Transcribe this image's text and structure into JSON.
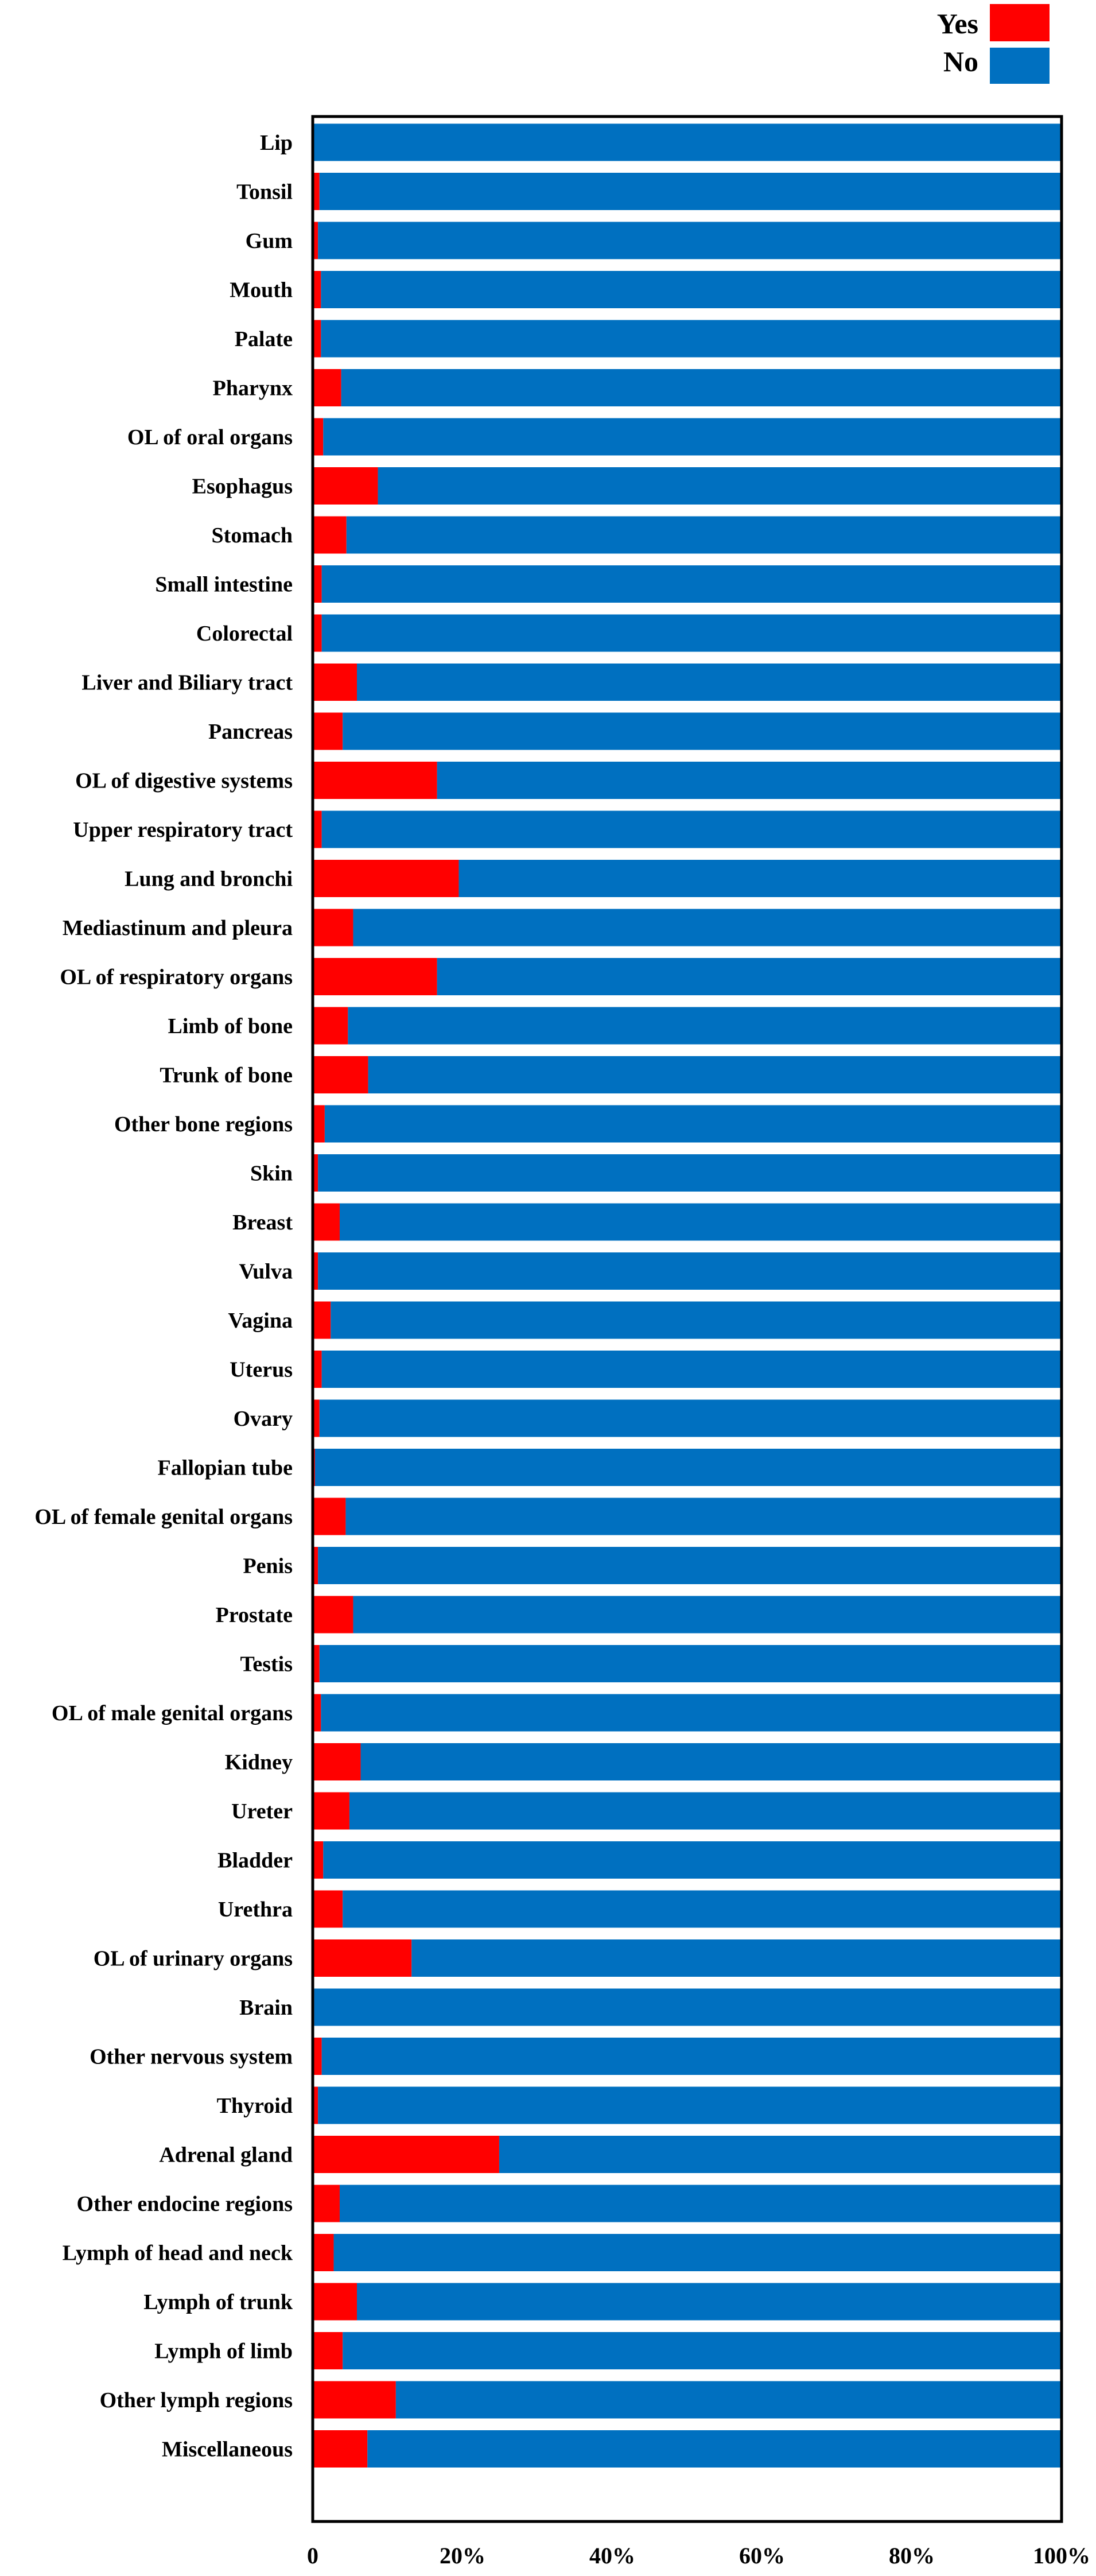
{
  "chart_data": {
    "type": "bar",
    "orientation": "horizontal",
    "stacked": true,
    "normalized": true,
    "title": "",
    "xlabel": "",
    "ylabel": "",
    "xlim": [
      0,
      100
    ],
    "x_ticks": [
      "0",
      "20%",
      "40%",
      "60%",
      "80%",
      "100%"
    ],
    "x_tick_values": [
      0,
      20,
      40,
      60,
      80,
      100
    ],
    "grid": false,
    "legend": {
      "placement": "top-right",
      "entries": [
        {
          "name": "Yes",
          "color": "#ff0000"
        },
        {
          "name": "No",
          "color": "#0070c0"
        }
      ]
    },
    "categories": [
      "Lip",
      "Tonsil",
      "Gum",
      "Mouth",
      "Palate",
      "Pharynx",
      "OL of oral organs",
      "Esophagus",
      "Stomach",
      "Small intestine",
      "Colorectal",
      "Liver and Biliary tract",
      "Pancreas",
      "OL of digestive systems",
      "Upper respiratory tract",
      "Lung and bronchi",
      "Mediastinum and pleura",
      "OL of respiratory organs",
      "Limb of bone",
      "Trunk of bone",
      "Other bone regions",
      "Skin",
      "Breast",
      "Vulva",
      "Vagina",
      "Uterus",
      "Ovary",
      "Fallopian tube",
      "OL of female genital organs",
      "Penis",
      "Prostate",
      "Testis",
      "OL of male genital organs",
      "Kidney",
      "Ureter",
      "Bladder",
      "Urethra",
      "OL of urinary organs",
      "Brain",
      "Other nervous system",
      "Thyroid",
      "Adrenal gland",
      "Other endocine regions",
      "Lymph of head and neck",
      "Lymph of trunk",
      "Lymph of limb",
      "Other lymph regions",
      "Miscellaneous"
    ],
    "series": [
      {
        "name": "Yes",
        "color": "#ff0000",
        "values": [
          0.0,
          0.9,
          0.7,
          1.1,
          1.1,
          3.8,
          1.4,
          8.7,
          4.5,
          1.2,
          1.2,
          5.9,
          4.0,
          16.6,
          1.2,
          19.5,
          5.4,
          16.6,
          4.7,
          7.4,
          1.6,
          0.7,
          3.6,
          0.7,
          2.4,
          1.2,
          0.9,
          0.3,
          4.4,
          0.7,
          5.4,
          0.9,
          1.1,
          6.4,
          4.9,
          1.4,
          4.0,
          13.2,
          0.2,
          1.2,
          0.7,
          24.9,
          3.6,
          2.8,
          5.9,
          4.0,
          11.1,
          7.3
        ]
      },
      {
        "name": "No",
        "color": "#0070c0",
        "values": [
          100.0,
          99.1,
          99.3,
          98.9,
          98.9,
          96.2,
          98.6,
          91.3,
          95.5,
          98.8,
          98.8,
          94.1,
          96.0,
          83.4,
          98.8,
          80.5,
          94.6,
          83.4,
          95.3,
          92.6,
          98.4,
          99.3,
          96.4,
          99.3,
          97.6,
          98.8,
          99.1,
          99.7,
          95.6,
          99.3,
          94.6,
          99.1,
          98.9,
          93.6,
          95.1,
          98.6,
          96.0,
          86.8,
          99.8,
          98.8,
          99.3,
          75.1,
          96.4,
          97.2,
          94.1,
          96.0,
          88.9,
          92.7
        ]
      }
    ]
  }
}
